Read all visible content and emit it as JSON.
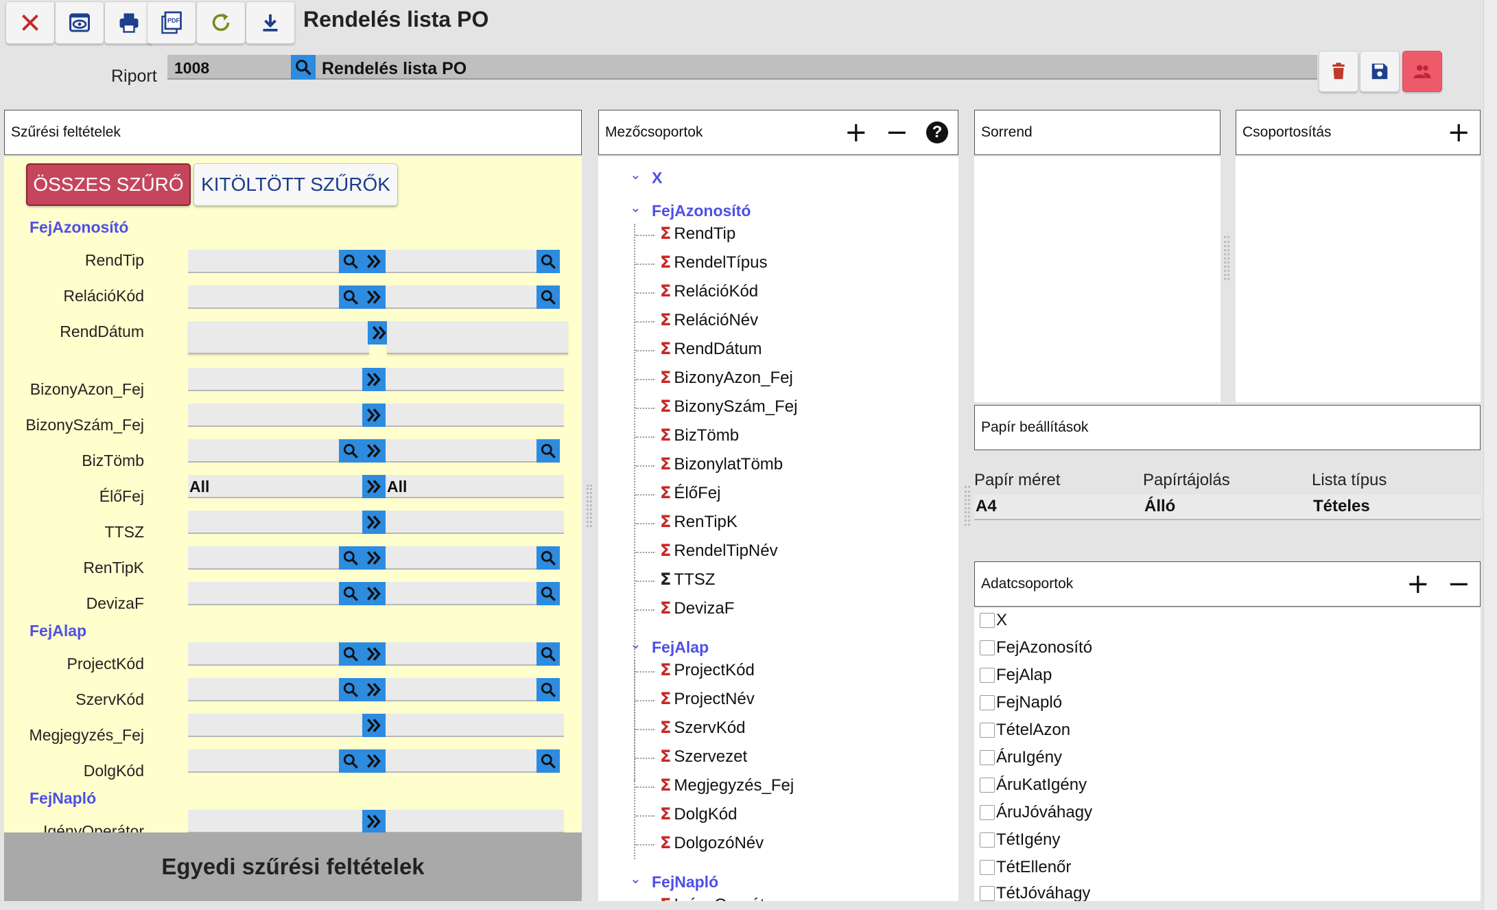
{
  "toolbar": {
    "title": "Rendelés lista PO",
    "buttons": [
      "close-icon",
      "preview-icon",
      "print-icon",
      "pdf-icon",
      "refresh-icon",
      "download-icon"
    ]
  },
  "riport": {
    "label": "Riport",
    "code": "1008",
    "name": "Rendelés lista PO"
  },
  "filters": {
    "title": "Szűrési feltételek",
    "all_label": "ÖSSZES SZŰRŐ",
    "filled_label": "KITÖLTÖTT SZŰRŐK",
    "bottom_label": "Egyedi szűrési feltételek",
    "groups": {
      "fejazonosito": "FejAzonosító",
      "fejalap": "FejAlap",
      "fejnaplo": "FejNapló"
    },
    "fields": {
      "rendtip": "RendTip",
      "relaciokod": "RelációKód",
      "renddatum": "RendDátum",
      "bizonyazon": "BizonyAzon_Fej",
      "bizonyszam": "BizonySzám_Fej",
      "biztomb": "BizTömb",
      "elofej": "ÉlőFej",
      "ttsz": "TTSZ",
      "rentipk": "RenTipK",
      "devizaf": "DevizaF",
      "projectkod": "ProjectKód",
      "szervkod": "SzervKód",
      "megjegyzes": "Megjegyzés_Fej",
      "dolgkod": "DolgKód",
      "igenyoperator": "IgényOperátor"
    },
    "elofej_from": "All",
    "elofej_to": "All"
  },
  "fieldgroups": {
    "title": "Mezőcsoportok",
    "plus": "+",
    "minus": "−",
    "help": "?",
    "x_label": "X",
    "grp1": "FejAzonosító",
    "grp1_items": [
      "RendTip",
      "RendelTípus",
      "RelációKód",
      "RelációNév",
      "RendDátum",
      "BizonyAzon_Fej",
      "BizonySzám_Fej",
      "BizTömb",
      "BizonylatTömb",
      "ÉlőFej",
      "RenTipK",
      "RendelTipNév",
      "TTSZ",
      "DevizaF"
    ],
    "grp2": "FejAlap",
    "grp2_items": [
      "ProjectKód",
      "ProjectNév",
      "SzervKód",
      "Szervezet",
      "Megjegyzés_Fej",
      "DolgKód",
      "DolgozóNév"
    ],
    "grp3": "FejNapló",
    "grp3_items": [
      "IgényOperát"
    ]
  },
  "sorrend": {
    "title": "Sorrend"
  },
  "csoport": {
    "title": "Csoportosítás",
    "plus": "+"
  },
  "paper": {
    "title": "Papír beállítások",
    "size_label": "Papír méret",
    "orient_label": "Papírtájolás",
    "list_label": "Lista típus",
    "size_value": "A4",
    "orient_value": "Álló",
    "list_value": "Tételes"
  },
  "datagroups": {
    "title": "Adatcsoportok",
    "plus": "+",
    "minus": "−",
    "items": [
      "X",
      "FejAzonosító",
      "FejAlap",
      "FejNapló",
      "TételAzon",
      "ÁruIgény",
      "ÁruKatIgény",
      "ÁruJóváhagy",
      "TétIgény",
      "TétEllenőr",
      "TétJóváhagy"
    ]
  },
  "colors": {
    "accent_blue": "#2d8be0",
    "group_blue": "#4f4fe6",
    "danger_red": "#c5465c",
    "filter_bg": "#ffffcd"
  }
}
